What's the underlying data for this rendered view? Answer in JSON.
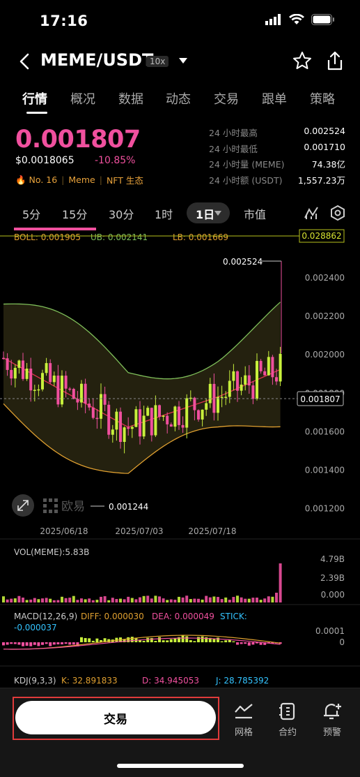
{
  "status_bar": {
    "time": "17:16"
  },
  "header": {
    "pair": "MEME/USDT",
    "leverage": "10x"
  },
  "tabs": [
    "行情",
    "概况",
    "数据",
    "动态",
    "交易",
    "跟单",
    "策略"
  ],
  "price": {
    "last": "0.001807",
    "usd": "$0.0018065",
    "change": "-10.85%",
    "tags": [
      "🔥 No. 16",
      "Meme",
      "NFT 生态"
    ]
  },
  "stats": [
    {
      "label": "24 小时最高",
      "value": "0.002524"
    },
    {
      "label": "24 小时最低",
      "value": "0.001710"
    },
    {
      "label": "24 小时量 (MEME)",
      "value": "74.38亿"
    },
    {
      "label": "24 小时额 (USDT)",
      "value": "1,557.23万"
    }
  ],
  "intervals": [
    "5分",
    "15分",
    "30分",
    "1时",
    "1日",
    "市值"
  ],
  "chart": {
    "boll_label": "BOLL: 0.001905",
    "ub_label": "UB: 0.002141",
    "lb_label": "LB: 0.001669",
    "top_tag": "0.028862",
    "high_marker": "0.002524",
    "low_marker": "0.001244",
    "current_tag": "0.001807",
    "y_ticks": [
      "0.002400",
      "0.002200",
      "0.002000",
      "0.001800",
      "0.001600",
      "0.001400",
      "0.001200"
    ],
    "x_ticks": [
      "2025/06/18",
      "2025/07/03",
      "2025/07/18"
    ],
    "watermark": "欧易",
    "vol_label": "VOL(MEME):5.83B",
    "vol_ticks": [
      "4.79B",
      "2.39B",
      "0.000"
    ],
    "macd_label": "MACD(12,26,9)",
    "macd_diff": "DIFF: 0.000030",
    "macd_dea": "DEA: 0.000049",
    "macd_stick": "STICK:",
    "macd_stick_val": "-0.000037",
    "macd_ticks": [
      "0.0001",
      "0"
    ],
    "kdj_label": "KDJ(9,3,3)",
    "kdj_k": "K: 32.891833",
    "kdj_d": "D: 34.945053",
    "kdj_j": "J: 28.785392"
  },
  "bottom": {
    "trade": "交易",
    "grid": "网格",
    "contract": "合约",
    "alert": "预警"
  },
  "colors": {
    "up": "#c8f03c",
    "down": "#f0509e",
    "ub": "#7fbf5a",
    "mid": "#e0334f",
    "lb": "#e0a030"
  }
}
